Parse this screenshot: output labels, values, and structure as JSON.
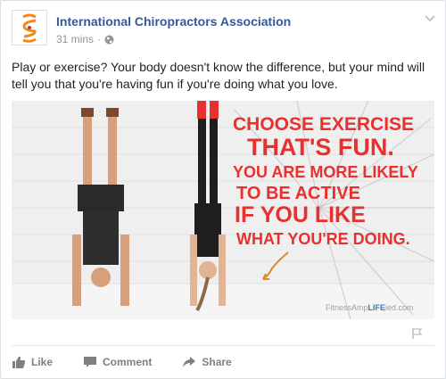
{
  "post": {
    "page_name": "International Chiropractors Association",
    "timestamp": "31 mins",
    "separator": "·",
    "privacy_icon": "globe-icon",
    "text": "Play or exercise? Your body doesn't know the difference, but your mind will tell you that you're having fun if you're doing what you love."
  },
  "image": {
    "lines": [
      "CHOOSE EXERCISE",
      "THAT'S FUN.",
      "YOU ARE MORE LIKELY",
      "TO BE ACTIVE",
      "IF YOU LIKE",
      "WHAT YOU'RE DOING."
    ],
    "watermark_pre": "FitnessAmp",
    "watermark_mid": "LIFE",
    "watermark_post": "ied.com",
    "accent_color": "#e8312f"
  },
  "actions": {
    "like": "Like",
    "comment": "Comment",
    "share": "Share"
  },
  "colors": {
    "link": "#365899",
    "meta": "#90949c",
    "action": "#7f7f7f"
  }
}
